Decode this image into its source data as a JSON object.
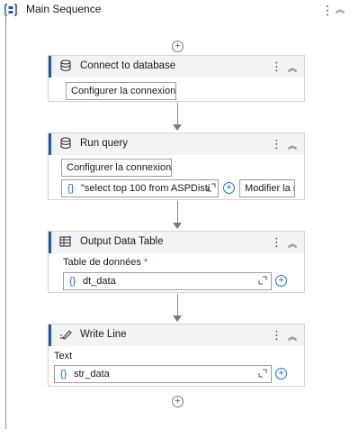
{
  "sequence": {
    "title": "Main Sequence"
  },
  "activities": [
    {
      "title": "Connect to database",
      "button_label": "Configurer la connexion..."
    },
    {
      "title": "Run query",
      "button_label": "Configurer la connexion...",
      "expression": "\"select top 100 from ASPDisti",
      "modify_label": "Modifier la r"
    },
    {
      "title": "Output Data Table",
      "field_label": "Table de données",
      "required_marker": "*",
      "expression": "dt_data"
    },
    {
      "title": "Write Line",
      "field_label": "Text",
      "expression": "str_data"
    }
  ],
  "icons": {
    "sequence": "sequence-icon",
    "database": "database-icon",
    "table": "data-table-icon",
    "write_line": "write-line-icon",
    "add": "plus-circle-icon",
    "expand": "expand-icon",
    "more": "kebab-icon",
    "collapse": "chevron-double-up-icon"
  },
  "colors": {
    "accent": "#1e5aa8",
    "expression_brace": "#1e6fd9",
    "required": "#c4314b"
  }
}
